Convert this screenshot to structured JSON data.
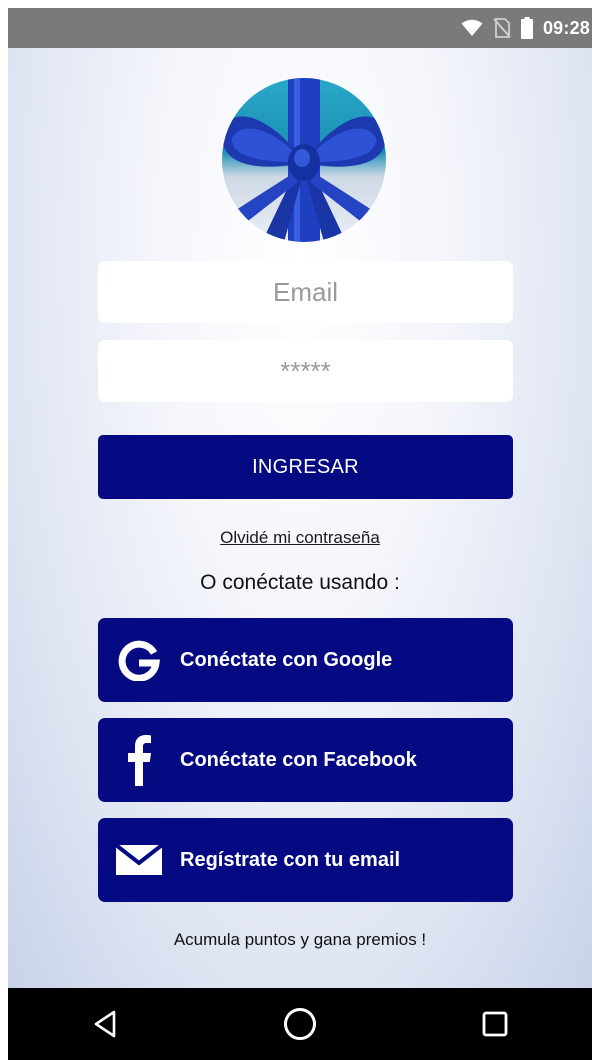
{
  "status_bar": {
    "time": "09:28",
    "icons": [
      "wifi-icon",
      "no-sim-icon",
      "battery-icon"
    ]
  },
  "logo": {
    "icon": "gift-bow-logo"
  },
  "form": {
    "email_placeholder": "Email",
    "password_placeholder": "*****",
    "submit_label": "INGRESAR",
    "forgot_label": "Olvidé mi contraseña"
  },
  "social": {
    "heading": "O conéctate usando :",
    "google_label": "Conéctate con Google",
    "facebook_label": "Conéctate con Facebook",
    "email_label": "Regístrate con tu email"
  },
  "footer": {
    "text": "Acumula puntos y gana premios !"
  },
  "nav": {
    "icons": [
      "back-icon",
      "home-icon",
      "recents-icon"
    ]
  },
  "colors": {
    "primary": "#050a82",
    "status_bar": "#7a7a7a",
    "nav_bar": "#000000",
    "background_center": "#ffffff",
    "background_edge": "#c9d2ea"
  }
}
